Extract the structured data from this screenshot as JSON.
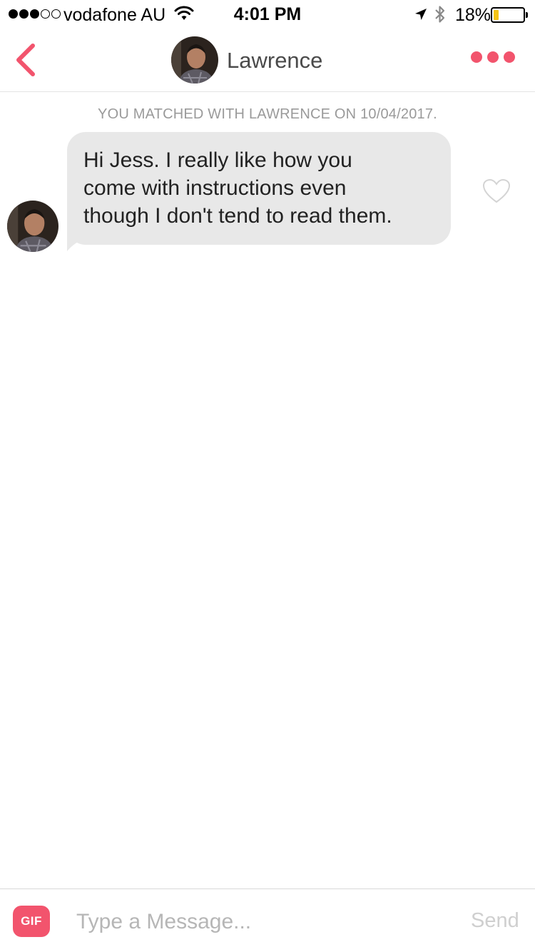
{
  "status_bar": {
    "signal_bars_filled": 3,
    "signal_bars_total": 5,
    "carrier": "vodafone AU",
    "time": "4:01 PM",
    "battery_percent_label": "18%",
    "battery_level": 0.18,
    "icons": [
      "wifi-icon",
      "location-arrow-icon",
      "bluetooth-icon",
      "battery-icon"
    ]
  },
  "header": {
    "contact_name": "Lawrence",
    "back_icon": "chevron-left-icon",
    "more_icon": "more-dots-icon"
  },
  "chat": {
    "match_notice": "YOU MATCHED WITH LAWRENCE ON 10/04/2017.",
    "messages": [
      {
        "sender": "Lawrence",
        "lines": [
          "Hi Jess. I really like how you",
          "come with instructions even",
          "though I don't tend to read them."
        ],
        "liked": false
      }
    ]
  },
  "composer": {
    "gif_label": "GIF",
    "placeholder": "Type a Message...",
    "value": "",
    "send_label": "Send"
  },
  "colors": {
    "accent": "#f2546d",
    "bubble": "#e8e8e8",
    "battery_fill": "#f5c518",
    "muted_text": "#9a9a9a"
  }
}
